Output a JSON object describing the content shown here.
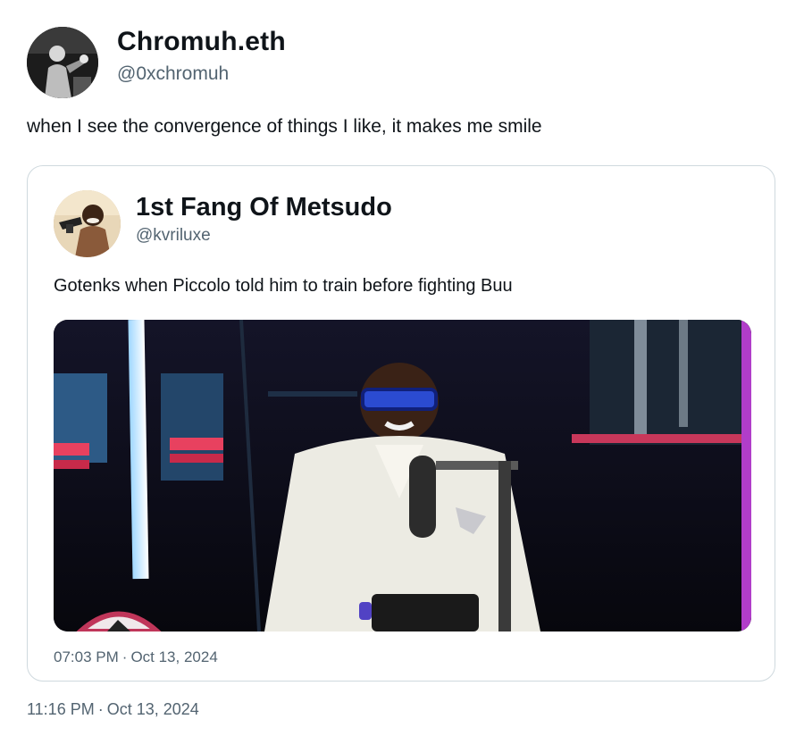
{
  "tweet": {
    "author_name": "Chromuh.eth",
    "author_handle": "@0xchromuh",
    "text": "when I see the convergence of things I like, it makes me smile",
    "time": "11:16 PM",
    "date": "Oct 13, 2024",
    "separator": "·"
  },
  "quoted": {
    "author_name": "1st Fang Of Metsudo",
    "author_handle": "@kvriluxe",
    "text": "Gotenks when Piccolo told him to train before fighting Buu",
    "time": "07:03 PM",
    "date": "Oct 13, 2024",
    "separator": "·"
  },
  "colors": {
    "text": "#0f1419",
    "secondary": "#536471",
    "border": "#cfd9de"
  }
}
